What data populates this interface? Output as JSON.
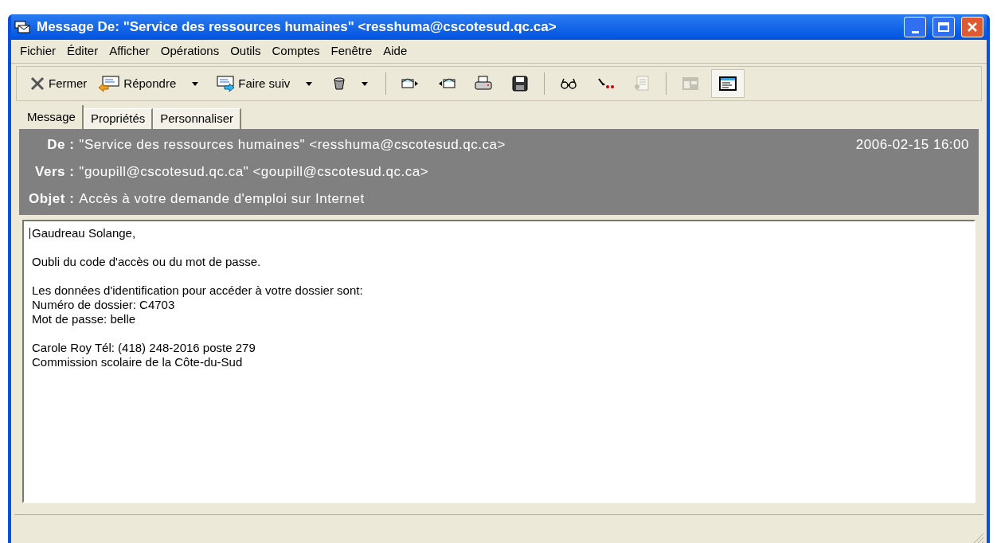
{
  "window": {
    "title": "Message De: \"Service des ressources humaines\" <resshuma@cscotesud.qc.ca>"
  },
  "menu": [
    "Fichier",
    "Éditer",
    "Afficher",
    "Opérations",
    "Outils",
    "Comptes",
    "Fenêtre",
    "Aide"
  ],
  "toolbar": [
    {
      "kind": "labeled",
      "label": "Fermer",
      "dropdown": false
    },
    {
      "kind": "labeled",
      "label": "Répondre",
      "dropdown": true
    },
    {
      "kind": "labeled",
      "label": "Faire suiv",
      "dropdown": true
    },
    {
      "kind": "icon",
      "dropdown": true,
      "disabled": false,
      "selected": false
    },
    {
      "kind": "separator"
    },
    {
      "kind": "icon",
      "dropdown": false,
      "disabled": false,
      "selected": false
    },
    {
      "kind": "icon",
      "dropdown": false,
      "disabled": false,
      "selected": false
    },
    {
      "kind": "icon",
      "dropdown": false,
      "disabled": false,
      "selected": false
    },
    {
      "kind": "icon",
      "dropdown": false,
      "disabled": false,
      "selected": false
    },
    {
      "kind": "separator"
    },
    {
      "kind": "icon",
      "dropdown": false,
      "disabled": false,
      "selected": false
    },
    {
      "kind": "icon",
      "dropdown": false,
      "disabled": false,
      "selected": false
    },
    {
      "kind": "icon",
      "dropdown": false,
      "disabled": true,
      "selected": false
    },
    {
      "kind": "separator"
    },
    {
      "kind": "icon",
      "dropdown": false,
      "disabled": true,
      "selected": false
    },
    {
      "kind": "icon",
      "dropdown": false,
      "disabled": false,
      "selected": true
    }
  ],
  "tabs": [
    {
      "label": "Message",
      "selected": true
    },
    {
      "label": "Propriétés",
      "selected": false
    },
    {
      "label": "Personnaliser",
      "selected": false
    }
  ],
  "header": {
    "fields": [
      {
        "label": "De :",
        "value": "\"Service des ressources humaines\" <resshuma@cscotesud.qc.ca>"
      },
      {
        "label": "Vers :",
        "value": "\"goupill@cscotesud.qc.ca\" <goupill@cscotesud.qc.ca>"
      },
      {
        "label": "Objet :",
        "value": "Accès à votre demande d'emploi sur Internet"
      }
    ],
    "date": "2006-02-15 16:00"
  },
  "body": {
    "paragraphs": [
      [
        "Gaudreau Solange,"
      ],
      [
        "Oubli du code d'accès ou du mot de passe."
      ],
      [
        "Les données d'identification pour accéder à votre dossier sont:",
        "Numéro de dossier: C4703",
        "Mot de passe: belle"
      ],
      [
        "Carole Roy Tél: (418) 248-2016 poste 279",
        "Commission scolaire de la Côte-du-Sud"
      ]
    ]
  }
}
